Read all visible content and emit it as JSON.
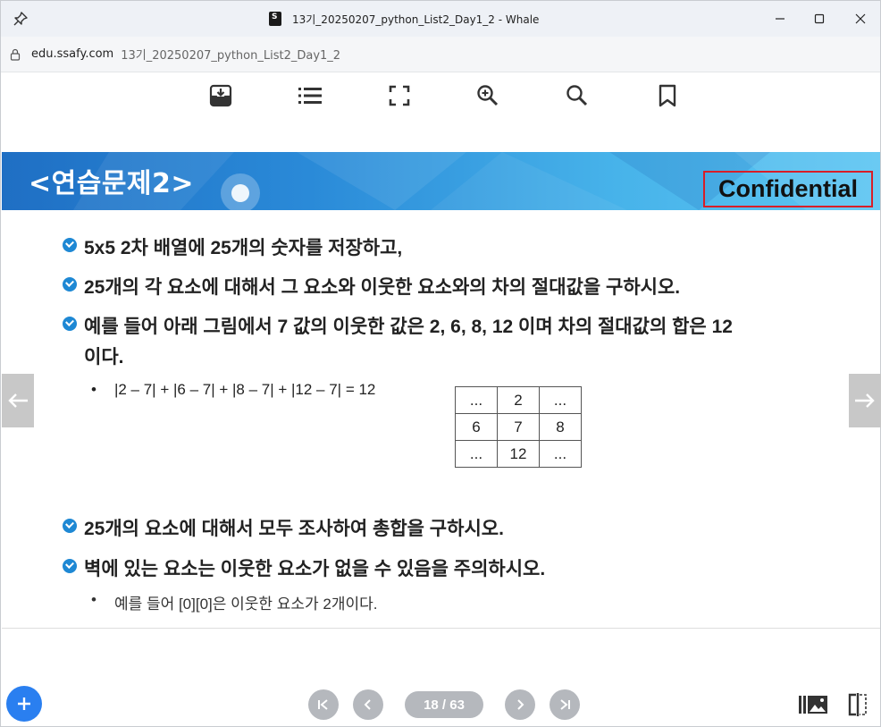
{
  "window": {
    "title": "13기_20250207_python_List2_Day1_2 - Whale",
    "controls": {
      "minimize": "—",
      "maximize": "☐",
      "close": "✕"
    }
  },
  "address": {
    "domain": "edu.ssafy.com",
    "path": "13기_20250207_python_List2_Day1_2"
  },
  "toolbar": {
    "icons": [
      "download-icon",
      "list-icon",
      "fullscreen-icon",
      "zoom-in-icon",
      "search-icon",
      "bookmark-icon"
    ]
  },
  "slide": {
    "title": "<연습문제2>",
    "confidential": "Confidential",
    "bullets": [
      "5x5 2차 배열에 25개의 숫자를 저장하고,",
      "25개의 각 요소에 대해서 그 요소와 이웃한 요소와의 차의 절대값을 구하시오.",
      "예를 들어 아래 그림에서 7 값의 이웃한 값은 2, 6, 8, 12 이며 차의 절대값의 합은 12",
      "이다.",
      "25개의 요소에 대해서 모두 조사하여 총합을 구하시오.",
      "벽에 있는 요소는 이웃한 요소가 없을 수 있음을 주의하시오."
    ],
    "formula": "|2 – 7| + |6 – 7| + |8 – 7| + |12 – 7| = 12",
    "note": "예를 들어 [0][0]은 이웃한 요소가 2개이다.",
    "grid": [
      [
        "...",
        "2",
        "..."
      ],
      [
        "6",
        "7",
        "8"
      ],
      [
        "...",
        "12",
        "..."
      ]
    ],
    "colors": {
      "accent": "#1e88d4",
      "confidential_border": "#d81e28"
    }
  },
  "pager": {
    "page_label": "18 / 63",
    "current": 18,
    "total": 63
  }
}
